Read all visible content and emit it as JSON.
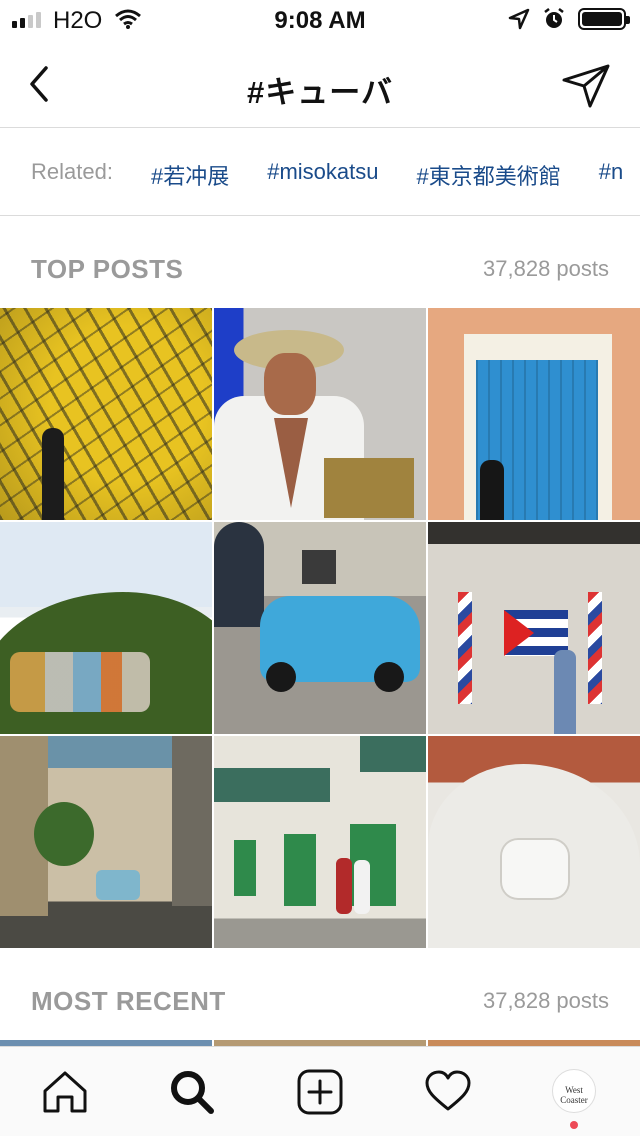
{
  "status_bar": {
    "carrier": "H2O",
    "time": "9:08 AM"
  },
  "nav": {
    "title": "#キューバ"
  },
  "related": {
    "label": "Related:",
    "tags": [
      "#若冲展",
      "#misokatsu",
      "#東京都美術館",
      "#n"
    ]
  },
  "top_posts": {
    "title": "TOP POSTS",
    "count": "37,828 posts"
  },
  "most_recent": {
    "title": "MOST RECENT",
    "count": "37,828 posts"
  },
  "profile": {
    "avatar_text": "West Coaster"
  },
  "colors": {
    "tag_link": "#1a4b8a",
    "muted_gray": "#9a9a9a",
    "notification_dot": "#ed4956"
  },
  "icons": [
    "signal-icon",
    "wifi-icon",
    "location-icon",
    "alarm-icon",
    "battery-icon",
    "back-chevron-icon",
    "send-icon",
    "home-icon",
    "search-icon",
    "add-icon",
    "heart-icon"
  ]
}
